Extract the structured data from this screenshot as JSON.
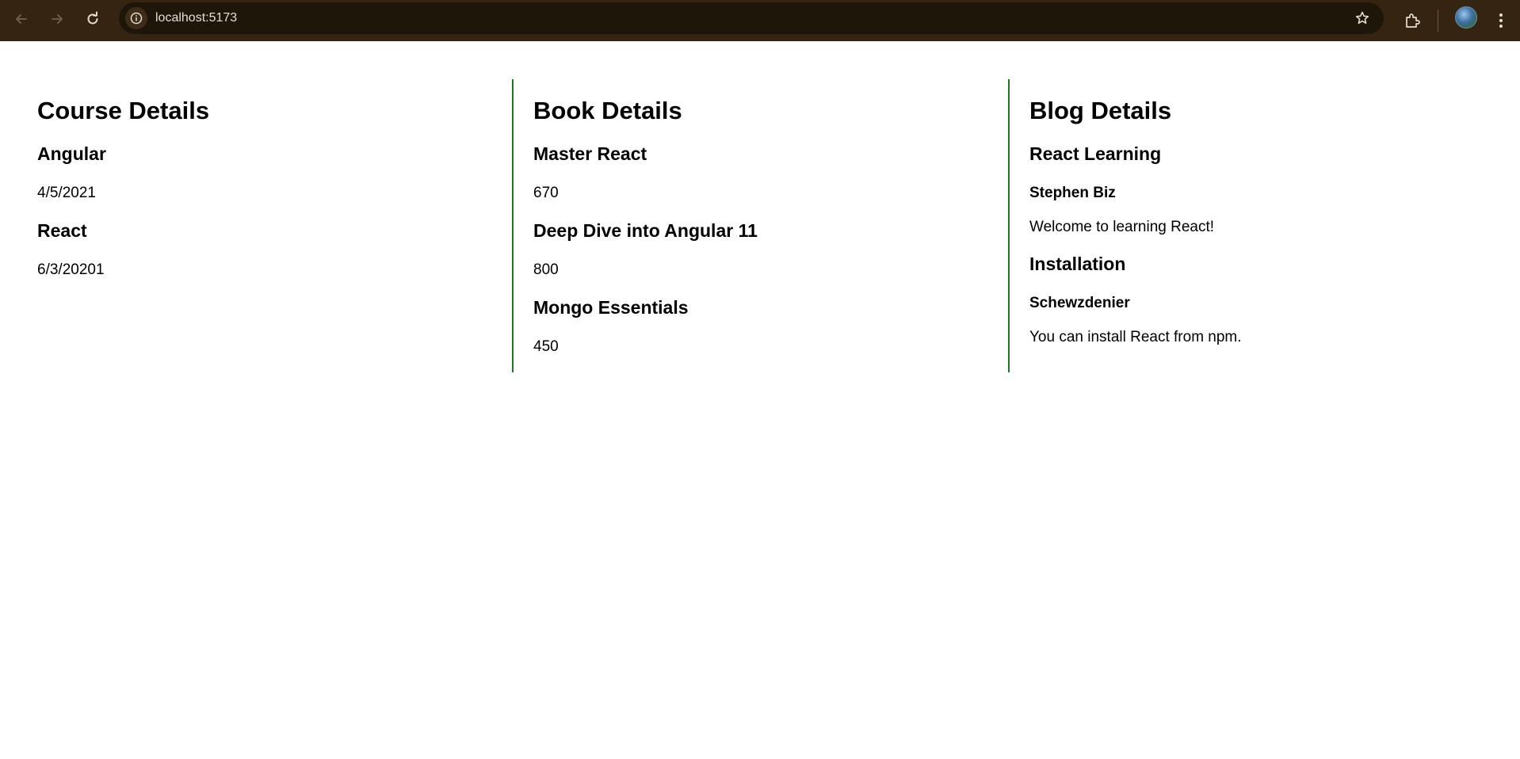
{
  "browser": {
    "url": "localhost:5173"
  },
  "course": {
    "heading": "Course Details",
    "items": [
      {
        "name": "Angular",
        "date": "4/5/2021"
      },
      {
        "name": "React",
        "date": "6/3/20201"
      }
    ]
  },
  "book": {
    "heading": "Book Details",
    "items": [
      {
        "name": "Master React",
        "price": "670"
      },
      {
        "name": "Deep Dive into Angular 11",
        "price": "800"
      },
      {
        "name": "Mongo Essentials",
        "price": "450"
      }
    ]
  },
  "blog": {
    "heading": "Blog Details",
    "items": [
      {
        "title": "React Learning",
        "author": "Stephen Biz",
        "content": "Welcome to learning React!"
      },
      {
        "title": "Installation",
        "author": "Schewzdenier",
        "content": "You can install React from npm."
      }
    ]
  },
  "colors": {
    "toolbar": "#342411",
    "divider": "#1f7a1f"
  }
}
